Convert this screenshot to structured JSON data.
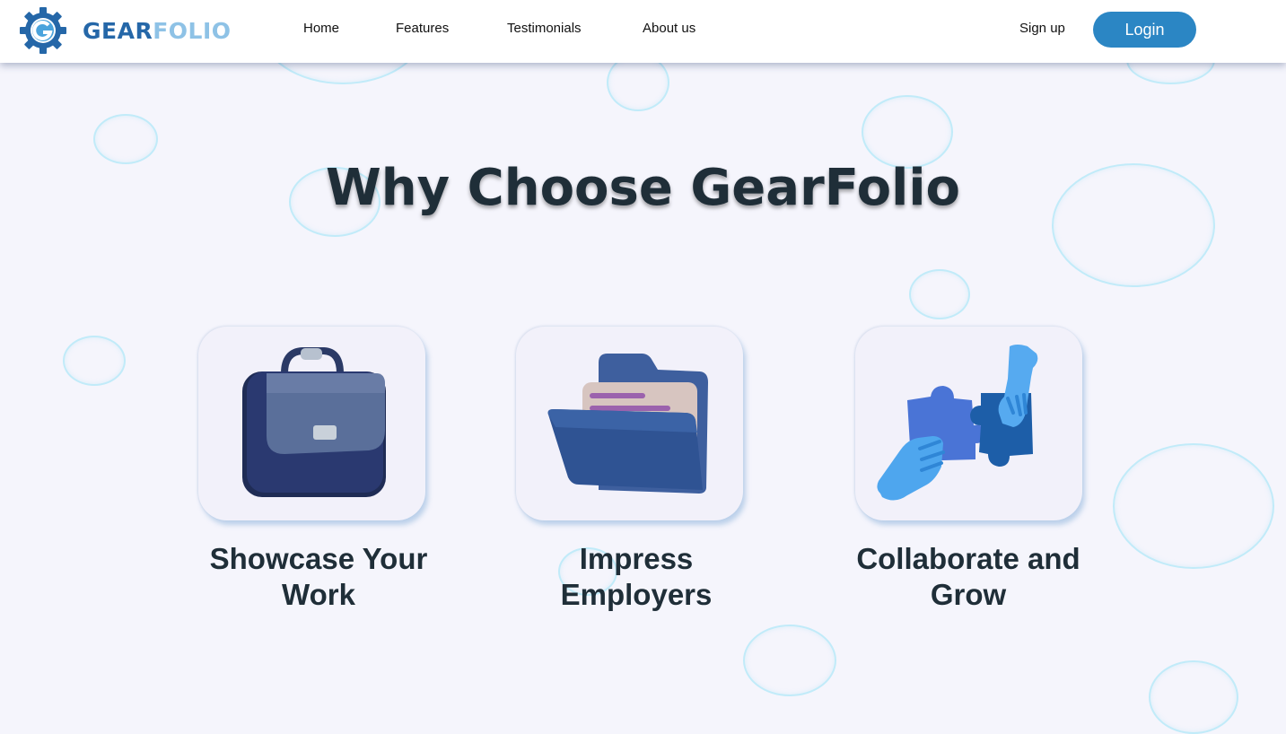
{
  "header": {
    "logo": {
      "part1": "GEAR",
      "part2": "FOLIO",
      "icon": "gear-logo-icon"
    },
    "nav": [
      {
        "label": "Home"
      },
      {
        "label": "Features"
      },
      {
        "label": "Testimonials"
      },
      {
        "label": "About us"
      }
    ],
    "signup_label": "Sign up",
    "login_label": "Login"
  },
  "main": {
    "title": "Why Choose GearFolio",
    "features": [
      {
        "icon": "briefcase-icon",
        "line1": "Showcase Your",
        "line2": "Work"
      },
      {
        "icon": "folder-icon",
        "line1": "Impress",
        "line2": "Employers"
      },
      {
        "icon": "puzzle-handshake-icon",
        "line1": "Collaborate and",
        "line2": "Grow"
      }
    ]
  },
  "colors": {
    "primary": "#2b86c4",
    "logo_dark": "#2567a8",
    "logo_light": "#8ec2e6",
    "heading": "#1f2e38",
    "background": "#f5f5fc"
  }
}
